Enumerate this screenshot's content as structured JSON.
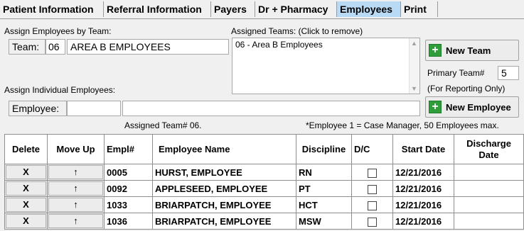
{
  "tabs": [
    "Patient Information",
    "Referral Information",
    "Payers",
    "Dr + Pharmacy",
    "Employees",
    "Print"
  ],
  "active_tab": "Employees",
  "assign_by_team": {
    "label": "Assign Employees by Team:",
    "team_label": "Team:",
    "team_number": "06",
    "team_name": "AREA B EMPLOYEES"
  },
  "assigned_teams": {
    "label": "Assigned Teams:  (Click to remove)",
    "items": [
      "06 - Area B Employees"
    ]
  },
  "buttons": {
    "new_team": "New Team",
    "new_employee": "New Employee"
  },
  "primary_team": {
    "label": "Primary Team#",
    "value": "5",
    "note": "(For Reporting Only)"
  },
  "assign_individual": {
    "label": "Assign Individual Employees:",
    "employee_label": "Employee:",
    "employee_value": ""
  },
  "status": {
    "assigned_team": "Assigned Team# 06.",
    "note": "*Employee 1 = Case Manager, 50 Employees max."
  },
  "table": {
    "headers": [
      "Delete",
      "Move Up",
      "Empl#",
      "Employee Name",
      "Discipline",
      "D/C",
      "Start Date",
      "Discharge Date"
    ],
    "delete_label": "X",
    "move_up_label": "↑",
    "rows": [
      {
        "empl": "0005",
        "name": "HURST, EMPLOYEE",
        "discipline": "RN",
        "start": "12/21/2016",
        "discharge": ""
      },
      {
        "empl": "0092",
        "name": "APPLESEED, EMPLOYEE",
        "discipline": "PT",
        "start": "12/21/2016",
        "discharge": ""
      },
      {
        "empl": "1033",
        "name": "BRIARPATCH, EMPLOYEE",
        "discipline": "HCT",
        "start": "12/21/2016",
        "discharge": ""
      },
      {
        "empl": "1036",
        "name": "BRIARPATCH, EMPLOYEE",
        "discipline": "MSW",
        "start": "12/21/2016",
        "discharge": ""
      }
    ]
  }
}
